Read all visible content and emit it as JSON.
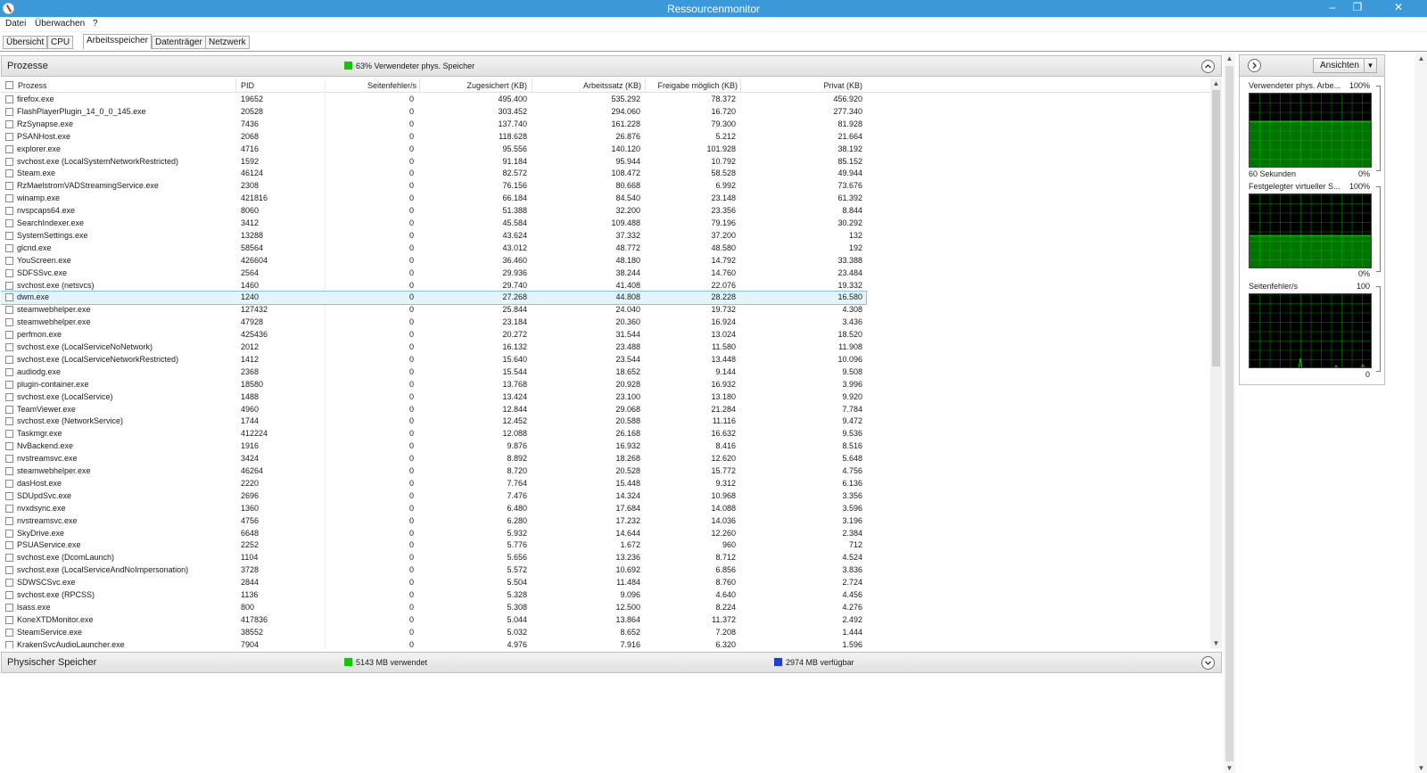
{
  "window": {
    "title": "Ressourcenmonitor",
    "controls": {
      "minimize": "–",
      "restore": "❐",
      "close": "✕"
    }
  },
  "menu": [
    "Datei",
    "Überwachen",
    "?"
  ],
  "tabs": [
    "Übersicht",
    "CPU",
    "Arbeitsspeicher",
    "Datenträger",
    "Netzwerk"
  ],
  "active_tab": "Arbeitsspeicher",
  "processes": {
    "title": "Prozesse",
    "summary": "63% Verwendeter phys. Speicher",
    "summary_color": "#19c20c",
    "columns": [
      "Prozess",
      "PID",
      "Seitenfehler/s",
      "Zugesichert (KB)",
      "Arbeitssatz (KB)",
      "Freigabe möglich (KB)",
      "Privat (KB)"
    ],
    "rows": [
      [
        "firefox.exe",
        "19652",
        "0",
        "495.400",
        "535.292",
        "78.372",
        "456.920"
      ],
      [
        "FlashPlayerPlugin_14_0_0_145.exe",
        "20528",
        "0",
        "303.452",
        "294.060",
        "16.720",
        "277.340"
      ],
      [
        "RzSynapse.exe",
        "7436",
        "0",
        "137.740",
        "161.228",
        "79.300",
        "81.928"
      ],
      [
        "PSANHost.exe",
        "2068",
        "0",
        "118.628",
        "26.876",
        "5.212",
        "21.664"
      ],
      [
        "explorer.exe",
        "4716",
        "0",
        "95.556",
        "140.120",
        "101.928",
        "38.192"
      ],
      [
        "svchost.exe (LocalSystemNetworkRestricted)",
        "1592",
        "0",
        "91.184",
        "95.944",
        "10.792",
        "85.152"
      ],
      [
        "Steam.exe",
        "46124",
        "0",
        "82.572",
        "108.472",
        "58.528",
        "49.944"
      ],
      [
        "RzMaelstromVADStreamingService.exe",
        "2308",
        "0",
        "76.156",
        "80.668",
        "6.992",
        "73.676"
      ],
      [
        "winamp.exe",
        "421816",
        "0",
        "66.184",
        "84.540",
        "23.148",
        "61.392"
      ],
      [
        "nvspcaps64.exe",
        "8060",
        "0",
        "51.388",
        "32.200",
        "23.356",
        "8.844"
      ],
      [
        "SearchIndexer.exe",
        "3412",
        "0",
        "45.584",
        "109.488",
        "79.196",
        "30.292"
      ],
      [
        "SystemSettings.exe",
        "13288",
        "0",
        "43.624",
        "37.332",
        "37.200",
        "132"
      ],
      [
        "glcnd.exe",
        "58564",
        "0",
        "43.012",
        "48.772",
        "48.580",
        "192"
      ],
      [
        "YouScreen.exe",
        "426604",
        "0",
        "36.460",
        "48.180",
        "14.792",
        "33.388"
      ],
      [
        "SDFSSvc.exe",
        "2564",
        "0",
        "29.936",
        "38.244",
        "14.760",
        "23.484"
      ],
      [
        "svchost.exe (netsvcs)",
        "1460",
        "0",
        "29.740",
        "41.408",
        "22.076",
        "19.332"
      ],
      [
        "dwm.exe",
        "1240",
        "0",
        "27.268",
        "44.808",
        "28.228",
        "16.580"
      ],
      [
        "steamwebhelper.exe",
        "127432",
        "0",
        "25.844",
        "24.040",
        "19.732",
        "4.308"
      ],
      [
        "steamwebhelper.exe",
        "47928",
        "0",
        "23.184",
        "20.360",
        "16.924",
        "3.436"
      ],
      [
        "perfmon.exe",
        "425436",
        "0",
        "20.272",
        "31.544",
        "13.024",
        "18.520"
      ],
      [
        "svchost.exe (LocalServiceNoNetwork)",
        "2012",
        "0",
        "16.132",
        "23.488",
        "11.580",
        "11.908"
      ],
      [
        "svchost.exe (LocalServiceNetworkRestricted)",
        "1412",
        "0",
        "15.640",
        "23.544",
        "13.448",
        "10.096"
      ],
      [
        "audiodg.exe",
        "2368",
        "0",
        "15.544",
        "18.652",
        "9.144",
        "9.508"
      ],
      [
        "plugin-container.exe",
        "18580",
        "0",
        "13.768",
        "20.928",
        "16.932",
        "3.996"
      ],
      [
        "svchost.exe (LocalService)",
        "1488",
        "0",
        "13.424",
        "23.100",
        "13.180",
        "9.920"
      ],
      [
        "TeamViewer.exe",
        "4960",
        "0",
        "12.844",
        "29.068",
        "21.284",
        "7.784"
      ],
      [
        "svchost.exe (NetworkService)",
        "1744",
        "0",
        "12.452",
        "20.588",
        "11.116",
        "9.472"
      ],
      [
        "Taskmgr.exe",
        "412224",
        "0",
        "12.088",
        "26.168",
        "16.632",
        "9.536"
      ],
      [
        "NvBackend.exe",
        "1916",
        "0",
        "9.876",
        "16.932",
        "8.416",
        "8.516"
      ],
      [
        "nvstreamsvc.exe",
        "3424",
        "0",
        "8.892",
        "18.268",
        "12.620",
        "5.648"
      ],
      [
        "steamwebhelper.exe",
        "46264",
        "0",
        "8.720",
        "20.528",
        "15.772",
        "4.756"
      ],
      [
        "dasHost.exe",
        "2220",
        "0",
        "7.764",
        "15.448",
        "9.312",
        "6.136"
      ],
      [
        "SDUpdSvc.exe",
        "2696",
        "0",
        "7.476",
        "14.324",
        "10.968",
        "3.356"
      ],
      [
        "nvxdsync.exe",
        "1360",
        "0",
        "6.480",
        "17.684",
        "14.088",
        "3.596"
      ],
      [
        "nvstreamsvc.exe",
        "4756",
        "0",
        "6.280",
        "17.232",
        "14.036",
        "3.196"
      ],
      [
        "SkyDrive.exe",
        "6648",
        "0",
        "5.932",
        "14.644",
        "12.260",
        "2.384"
      ],
      [
        "PSUAService.exe",
        "2252",
        "0",
        "5.776",
        "1.672",
        "960",
        "712"
      ],
      [
        "svchost.exe (DcomLaunch)",
        "1104",
        "0",
        "5.656",
        "13.236",
        "8.712",
        "4.524"
      ],
      [
        "svchost.exe (LocalServiceAndNoImpersonation)",
        "3728",
        "0",
        "5.572",
        "10.692",
        "6.856",
        "3.836"
      ],
      [
        "SDWSCSvc.exe",
        "2844",
        "0",
        "5.504",
        "11.484",
        "8.760",
        "2.724"
      ],
      [
        "svchost.exe (RPCSS)",
        "1136",
        "0",
        "5.328",
        "9.096",
        "4.640",
        "4.456"
      ],
      [
        "lsass.exe",
        "800",
        "0",
        "5.308",
        "12.500",
        "8.224",
        "4.276"
      ],
      [
        "KoneXTDMonitor.exe",
        "417836",
        "0",
        "5.044",
        "13.864",
        "11.372",
        "2.492"
      ],
      [
        "SteamService.exe",
        "38552",
        "0",
        "5.032",
        "8.652",
        "7.208",
        "1.444"
      ],
      [
        "KrakenSvcAudioLauncher.exe",
        "7904",
        "0",
        "4.976",
        "7.916",
        "6.320",
        "1.596"
      ]
    ],
    "selected_row": 16
  },
  "physical_memory": {
    "title": "Physischer Speicher",
    "used": "5143 MB verwendet",
    "used_color": "#19c20c",
    "available": "2974 MB verfügbar",
    "available_color": "#1f3fd0"
  },
  "side_panel": {
    "views_button": "Ansichten",
    "graphs": [
      {
        "title": "Verwendeter phys. Arbe...",
        "max": "100%",
        "footer_left": "60 Sekunden",
        "footer_right": "0%",
        "level": 0.63
      },
      {
        "title": "Festgelegter virtueller S...",
        "max": "100%",
        "footer_left": "",
        "footer_right": "0%",
        "level": 0.45
      },
      {
        "title": "Seitenfehler/s",
        "max": "100",
        "footer_left": "",
        "footer_right": "0",
        "level": 0.0
      }
    ],
    "graph_color": "#00d100",
    "grid_color": "#008000"
  },
  "icons": {
    "collapse": "chevron-up-icon",
    "expand": "chevron-down-icon",
    "side_toggle": "chevron-right-icon"
  }
}
